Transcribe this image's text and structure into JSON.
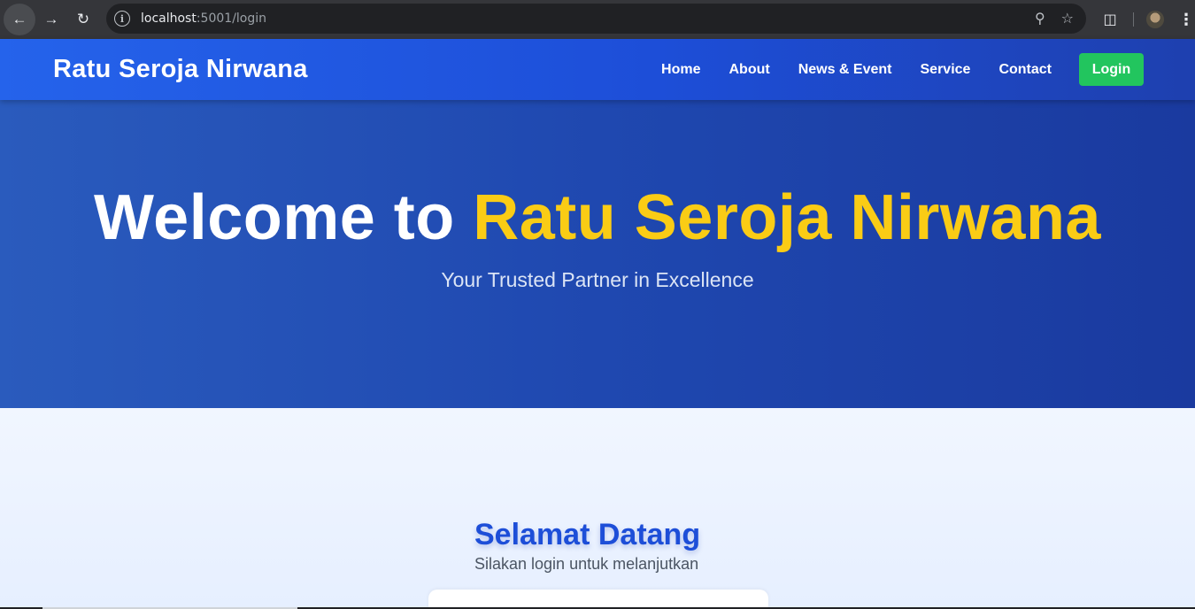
{
  "browser": {
    "url_host": "localhost",
    "url_path": ":5001/login",
    "icons": [
      "back-arrow-icon",
      "forward-arrow-icon",
      "reload-icon",
      "site-info-icon",
      "password-key-icon",
      "bookmark-star-icon",
      "extensions-icon",
      "profile-avatar",
      "menu-kebab-icon"
    ]
  },
  "header": {
    "brand": "Ratu Seroja Nirwana",
    "nav": [
      "Home",
      "About",
      "News & Event",
      "Service",
      "Contact"
    ],
    "login_label": "Login",
    "colors": {
      "header": "#2563eb",
      "login": "#22c55e"
    }
  },
  "hero": {
    "title_prefix": "Welcome to ",
    "title_highlight": "Ratu Seroja Nirwana",
    "subtitle": "Your Trusted Partner in Excellence",
    "colors": {
      "highlight": "#facc15"
    }
  },
  "login_section": {
    "title": "Selamat Datang",
    "subtitle": "Silakan login untuk melanjutkan"
  }
}
